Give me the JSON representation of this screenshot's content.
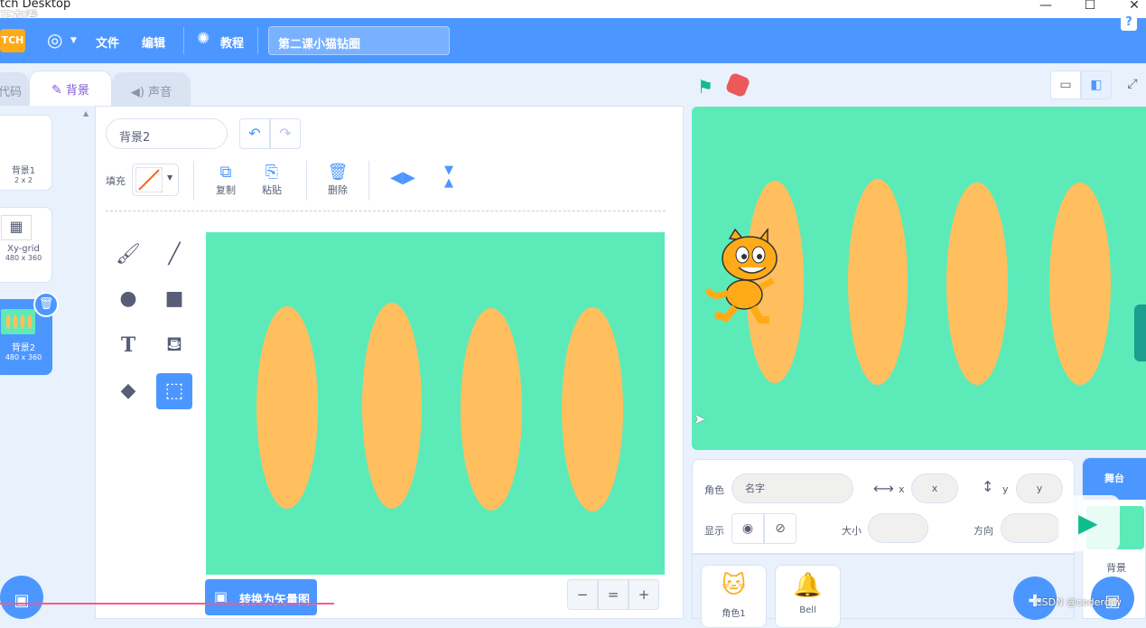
{
  "window": {
    "title": "tch Desktop",
    "caption": "正在看",
    "minimize": "—",
    "maximize": "☐",
    "close": "✕"
  },
  "menubar": {
    "language_icon": "globe-icon",
    "file": "文件",
    "edit": "编辑",
    "tutorials": "教程",
    "project_title": "第二课小猫钻圈",
    "help": "?"
  },
  "tabs": {
    "code": "代码",
    "backdrops": "背景",
    "sounds": "声音"
  },
  "costumes": [
    {
      "name": "背景1",
      "size": "2 x 2"
    },
    {
      "name": "Xy-grid",
      "size": "480 x 360"
    },
    {
      "name": "背景2",
      "size": "480 x 360"
    }
  ],
  "editor": {
    "costume_name": "背景2",
    "fill_label": "填充",
    "copy": "复制",
    "paste": "粘贴",
    "delete": "删除",
    "convert": "转换为矢量图",
    "zoom_out": "−",
    "zoom_reset": "=",
    "zoom_in": "+"
  },
  "sprite_info": {
    "sprite_label": "角色",
    "name_placeholder": "名字",
    "x_label": "x",
    "x_placeholder": "x",
    "y_label": "y",
    "y_placeholder": "y",
    "show_label": "显示",
    "size_label": "大小",
    "direction_label": "方向"
  },
  "sprites": [
    {
      "name": "角色1"
    },
    {
      "name": "Bell"
    }
  ],
  "stage_panel": {
    "stage_label": "舞台",
    "backdrops_label": "背景"
  },
  "watermark": "CSDN @coderdjw",
  "colors": {
    "accent": "#4c97ff",
    "canvas": "#5cebb8",
    "ellipse": "#ffbf5e",
    "flag": "#0fbd8c",
    "stop": "#ec5959"
  }
}
